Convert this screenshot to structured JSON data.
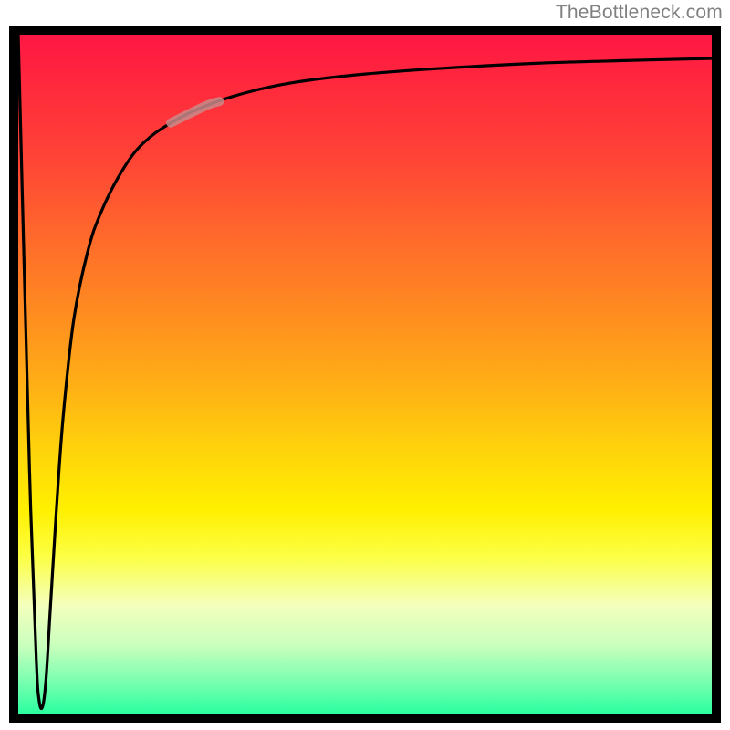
{
  "attribution": "TheBottleneck.com",
  "chart_data": {
    "type": "line",
    "title": "",
    "xlabel": "",
    "ylabel": "",
    "xlim": [
      0,
      100
    ],
    "ylim": [
      0,
      100
    ],
    "gradient_colors": {
      "top": "#ff1744",
      "middle": "#fff000",
      "bottom": "#2bffa0"
    },
    "series": [
      {
        "name": "bottleneck-curve",
        "x": [
          0.0,
          1.0,
          1.8,
          2.6,
          3.0,
          3.5,
          4.0,
          4.6,
          5.5,
          6.5,
          8.0,
          10.0,
          12.0,
          15.0,
          18.0,
          22.0,
          27.0,
          33.0,
          40.0,
          50.0,
          62.0,
          75.0,
          88.0,
          100.0
        ],
        "y": [
          100,
          60,
          30,
          8,
          2,
          1,
          5,
          15,
          30,
          44,
          58,
          68,
          74,
          80,
          84,
          87,
          89.5,
          91.5,
          93,
          94.2,
          95.1,
          95.8,
          96.2,
          96.5
        ]
      }
    ],
    "highlight_segment": {
      "x_range": [
        22.0,
        29.0
      ],
      "note": "faded/desaturated section of curve"
    },
    "notch": {
      "x": 3.0,
      "y": 1
    }
  }
}
